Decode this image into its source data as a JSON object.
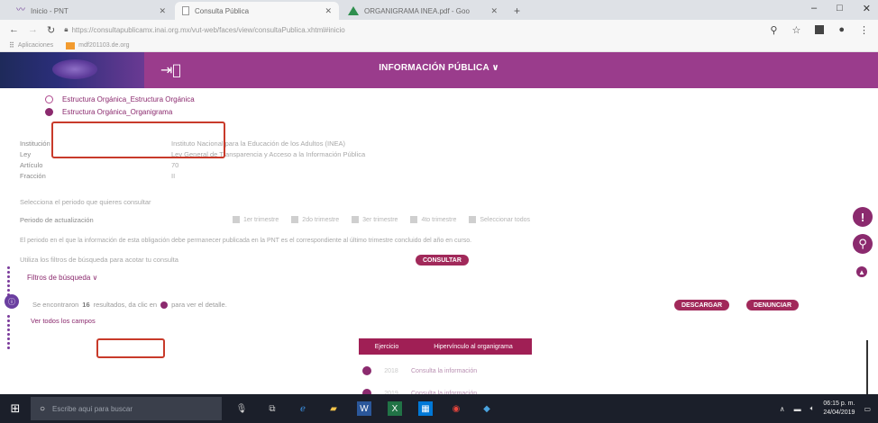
{
  "browser": {
    "tabs": [
      {
        "label": "Inicio - PNT",
        "icon": "pnt-favicon-icon",
        "active": false
      },
      {
        "label": "Consulta Pública",
        "icon": "document-favicon-icon",
        "active": true
      },
      {
        "label": "ORGANIGRAMA INEA.pdf - Goo",
        "icon": "google-drive-favicon-icon",
        "active": false
      }
    ],
    "new_tab": "+",
    "window_controls": [
      "–",
      "□",
      "✕"
    ],
    "address": "https://consultapublicamx.inai.org.mx/vut-web/faces/view/consultaPublica.xhtml#inicio",
    "bookmarks": [
      {
        "label": "Aplicaciones",
        "icon": "apps-grid-icon"
      },
      {
        "label": "mdf201103.de.org",
        "icon": "bookmark-folder-icon"
      }
    ]
  },
  "header": {
    "title": "INFORMACIÓN PÚBLICA ∨",
    "color": "#9a3c8c"
  },
  "options": [
    {
      "label": "Estructura Orgánica_Estructura Orgánica",
      "checked": false
    },
    {
      "label": "Estructura Orgánica_Organigrama",
      "checked": true
    }
  ],
  "info": [
    {
      "label": "Institución",
      "value": "Instituto Nacional para la Educación de los Adultos (INEA)"
    },
    {
      "label": "Ley",
      "value": "Ley General de Transparencia y Acceso a la Información Pública"
    },
    {
      "label": "Artículo",
      "value": "70"
    },
    {
      "label": "Fracción",
      "value": "II"
    }
  ],
  "period_prompt": "Selecciona el periodo que quieres consultar",
  "period_label": "Periodo de actualización",
  "periods": [
    "1er trimestre",
    "2do trimestre",
    "3er trimestre",
    "4to trimestre",
    "Seleccionar todos"
  ],
  "note": "El periodo en el que la información de esta obligación debe permanecer publicada en la PNT es el correspondiente al último trimestre concluido del año en curso.",
  "filters_prompt": "Utiliza los filtros de búsqueda para acotar tu consulta",
  "consult_button": "CONSULTAR",
  "filters_link": "Filtros de búsqueda ∨",
  "results": {
    "prefix": "Se encontraron",
    "count": "16",
    "suffix_a": "resultados, da clic en",
    "suffix_b": "para ver el detalle."
  },
  "all_fields": "Ver todos los campos",
  "download_button": "DESCARGAR",
  "report_button": "DENUNCIAR",
  "table": {
    "headers": [
      "Ejercicio",
      "Hipervínculo al organigrama"
    ],
    "rows": [
      {
        "year": "2018",
        "link": "Consulta la información"
      },
      {
        "year": "2019",
        "link": "Consulta la información"
      }
    ]
  },
  "taskbar": {
    "search_placeholder": "Escribe aquí para buscar",
    "time": "06:15 p. m.",
    "date": "24/04/2019"
  }
}
